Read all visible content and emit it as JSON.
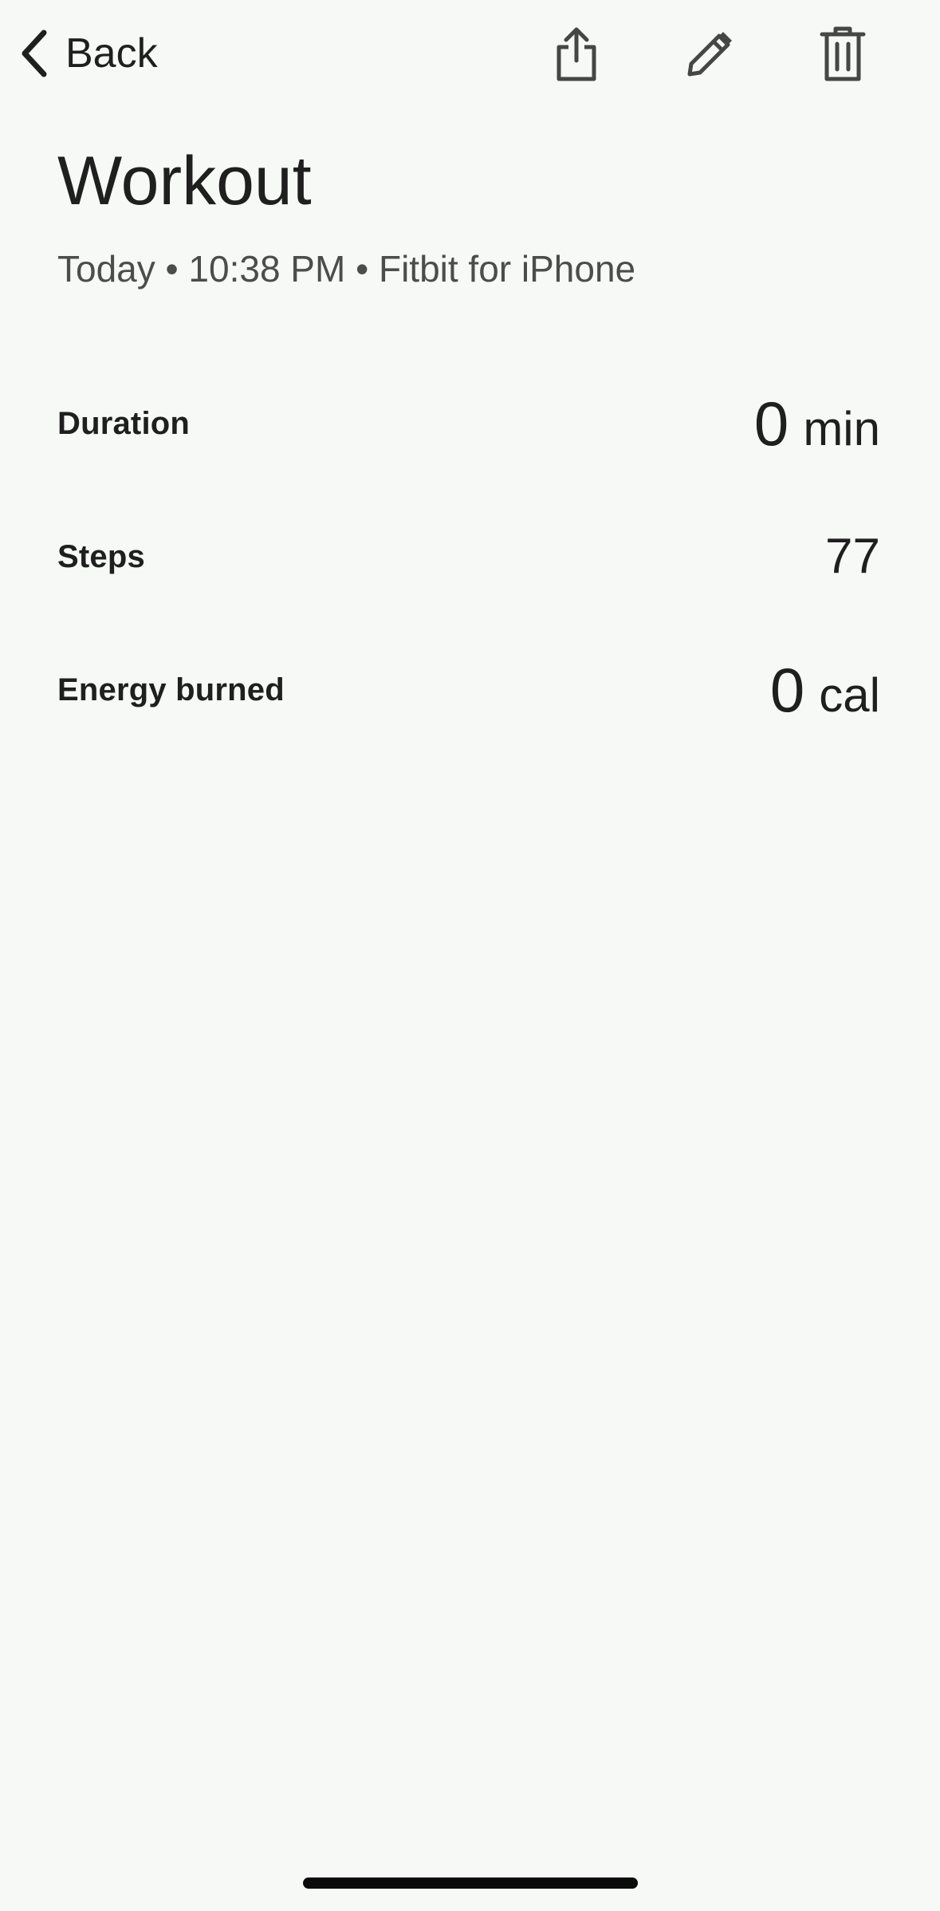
{
  "header": {
    "back_label": "Back",
    "actions": {
      "share_icon": "share-icon",
      "edit_icon": "pencil-icon",
      "delete_icon": "trash-icon"
    }
  },
  "workout": {
    "title": "Workout",
    "subtitle": "Today • 10:38 PM • Fitbit for iPhone"
  },
  "stats": {
    "duration": {
      "label": "Duration",
      "value": "0",
      "unit": "min"
    },
    "steps": {
      "label": "Steps",
      "value": "77"
    },
    "energy": {
      "label": "Energy burned",
      "value": "0",
      "unit": "cal"
    }
  },
  "colors": {
    "background": "#f7f9f7",
    "text_primary": "#1f1f1f",
    "text_secondary": "#4a4d4b",
    "icon": "#444746"
  }
}
